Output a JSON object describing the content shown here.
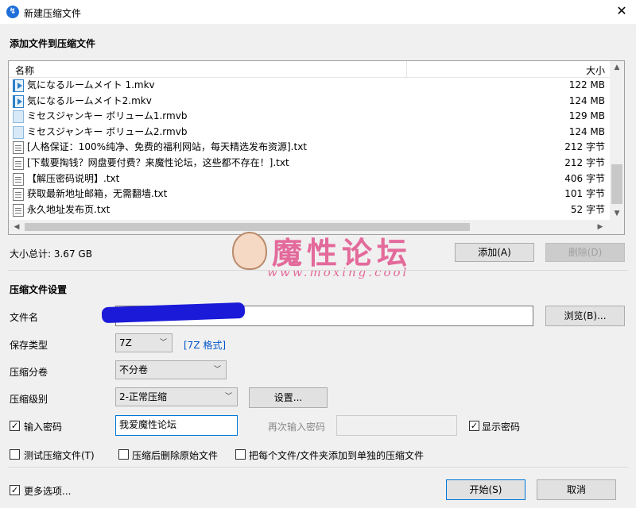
{
  "window": {
    "title": "新建压缩文件",
    "icon": "app-logo-icon"
  },
  "add_section": {
    "heading": "添加文件到压缩文件"
  },
  "file_list": {
    "headers": {
      "name": "名称",
      "size": "大小"
    },
    "rows": [
      {
        "name": "気になるルームメイト 1.mkv",
        "size": "122 MB",
        "icon": "video-file-icon"
      },
      {
        "name": "気になるルームメイト2.mkv",
        "size": "124 MB",
        "icon": "video-file-icon"
      },
      {
        "name": "ミセスジャンキー ボリューム1.rmvb",
        "size": "129 MB",
        "icon": "rmvb-file-icon"
      },
      {
        "name": "ミセスジャンキー ボリューム2.rmvb",
        "size": "124 MB",
        "icon": "rmvb-file-icon"
      },
      {
        "name": "[人格保证：100%纯净、免费的福利网站，每天精选发布资源].txt",
        "size": "212 字节",
        "icon": "text-file-icon"
      },
      {
        "name": "[下载要掏钱？网盘要付费？来魔性论坛，这些都不存在！].txt",
        "size": "212 字节",
        "icon": "text-file-icon"
      },
      {
        "name": "【解压密码说明】.txt",
        "size": "406 字节",
        "icon": "text-file-icon"
      },
      {
        "name": "获取最新地址邮箱，无需翻墙.txt",
        "size": "101 字节",
        "icon": "text-file-icon"
      },
      {
        "name": "永久地址发布页.txt",
        "size": "52 字节",
        "icon": "text-file-icon"
      }
    ]
  },
  "total": {
    "label": "大小总计: 3.67 GB"
  },
  "buttons": {
    "add": "添加(A)",
    "remove": "删除(D)",
    "browse": "浏览(B)...",
    "settings": "设置...",
    "start": "开始(S)",
    "cancel": "取消"
  },
  "archive_settings": {
    "heading": "压缩文件设置",
    "filename_label": "文件名",
    "filename_value": "",
    "type_label": "保存类型",
    "type_value": "7Z",
    "type_link": "[7Z 格式]",
    "volume_label": "压缩分卷",
    "volume_value": "不分卷",
    "level_label": "压缩级别",
    "level_value": "2-正常压缩"
  },
  "password": {
    "enable_label": "输入密码",
    "value": "我爱魔性论坛",
    "repeat_label": "再次输入密码",
    "show_label": "显示密码"
  },
  "options": {
    "test": "测试压缩文件(T)",
    "delete_after": "压缩后删除原始文件",
    "each_separate": "把每个文件/文件夹添加到单独的压缩文件",
    "more": "更多选项..."
  },
  "watermark": {
    "title": "魔性论坛",
    "url": "www.moxing.cool"
  }
}
